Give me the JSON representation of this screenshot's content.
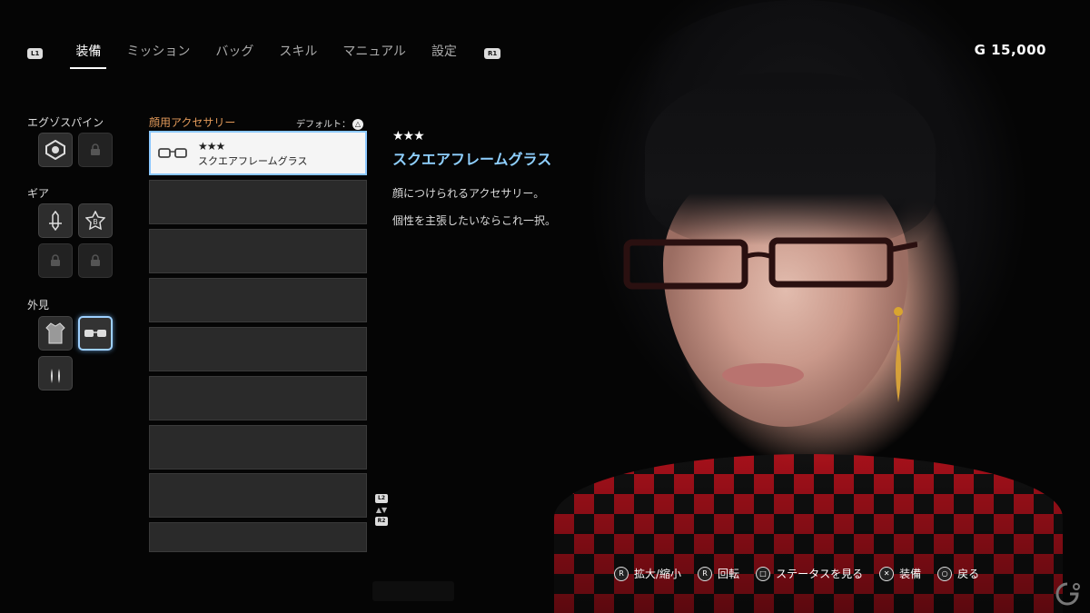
{
  "nav": {
    "left_shoulder": "L1",
    "right_shoulder": "R1",
    "tabs": [
      {
        "label": "装備"
      },
      {
        "label": "ミッション"
      },
      {
        "label": "バッグ"
      },
      {
        "label": "スキル"
      },
      {
        "label": "マニュアル"
      },
      {
        "label": "設定"
      }
    ],
    "active_tab": 0
  },
  "currency": "G 15,000",
  "slots": {
    "exospine_title": "エグゾスパイン",
    "gear_title": "ギア",
    "appearance_title": "外見"
  },
  "list": {
    "title": "顔用アクセサリー",
    "default_label": "デフォルト：",
    "default_button": "△",
    "items": [
      {
        "stars": "★★★",
        "name": "スクエアフレームグラス"
      }
    ],
    "scroll_up": "L2",
    "scroll_down": "R2",
    "arrows": "▲▼"
  },
  "detail": {
    "stars": "★★★",
    "name": "スクエアフレームグラス",
    "desc1": "顔につけられるアクセサリー。",
    "desc2": "個性を主張したいならこれ一択。"
  },
  "hints": [
    {
      "button": "R",
      "label": "拡大/縮小"
    },
    {
      "button": "R",
      "label": "回転"
    },
    {
      "button": "□",
      "label": "ステータスを見る"
    },
    {
      "button": "✕",
      "label": "装備"
    },
    {
      "button": "○",
      "label": "戻る"
    }
  ],
  "colors": {
    "accent_blue": "#8fd0ff",
    "list_title_orange": "#e39a5a",
    "selected_border": "#8cc8ff"
  }
}
